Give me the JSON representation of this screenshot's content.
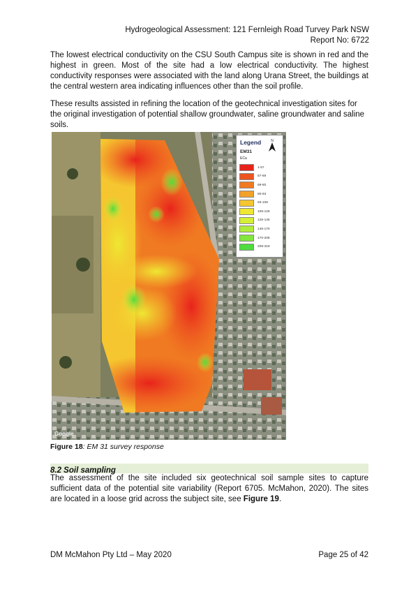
{
  "header": {
    "line1": "Hydrogeological Assessment: 121 Fernleigh Road Turvey Park NSW",
    "line2": "Report No: 6722"
  },
  "paragraph1": "The lowest electrical conductivity on the CSU South Campus site is shown in red and the highest in green. Most of the site had a low electrical conductivity. The highest conductivity responses were associated with the land along Urana Street, the buildings at the central western area indicating influences other than the soil profile.",
  "paragraph2": "These results assisted in refining the location of the geotechnical investigation sites for the original investigation of potential shallow groundwater, saline groundwater and saline soils.",
  "figure": {
    "legend": {
      "title": "Legend",
      "north_symbol": "N",
      "layer": "EM31",
      "unit": "ECa",
      "items": [
        {
          "range": "1-57",
          "color": "#e8231c"
        },
        {
          "range": "57-69",
          "color": "#ee5420"
        },
        {
          "range": "69-80",
          "color": "#f07a22"
        },
        {
          "range": "80-93",
          "color": "#f3a12b"
        },
        {
          "range": "93-108",
          "color": "#f5c62f"
        },
        {
          "range": "108-126",
          "color": "#eee832"
        },
        {
          "range": "126-146",
          "color": "#d4ef36"
        },
        {
          "range": "146-170",
          "color": "#b0ec3b"
        },
        {
          "range": "170-208",
          "color": "#82e63d"
        },
        {
          "range": "208-319",
          "color": "#4fdc3e"
        }
      ]
    },
    "watermark": "Google",
    "caption_label": "Figure 18",
    "caption_text": ": EM 31 survey response"
  },
  "section": {
    "heading": "8.2 Soil sampling"
  },
  "paragraph3": {
    "text": "The assessment of the site included six geotechnical soil sample sites to capture sufficient data of the potential site variability (Report 6705. McMahon, 2020). The sites are located in a loose grid across the subject site, see ",
    "ref": "Figure 19",
    "end": "."
  },
  "footer": {
    "left": "DM McMahon Pty Ltd – May 2020",
    "right": "Page 25 of 42"
  }
}
